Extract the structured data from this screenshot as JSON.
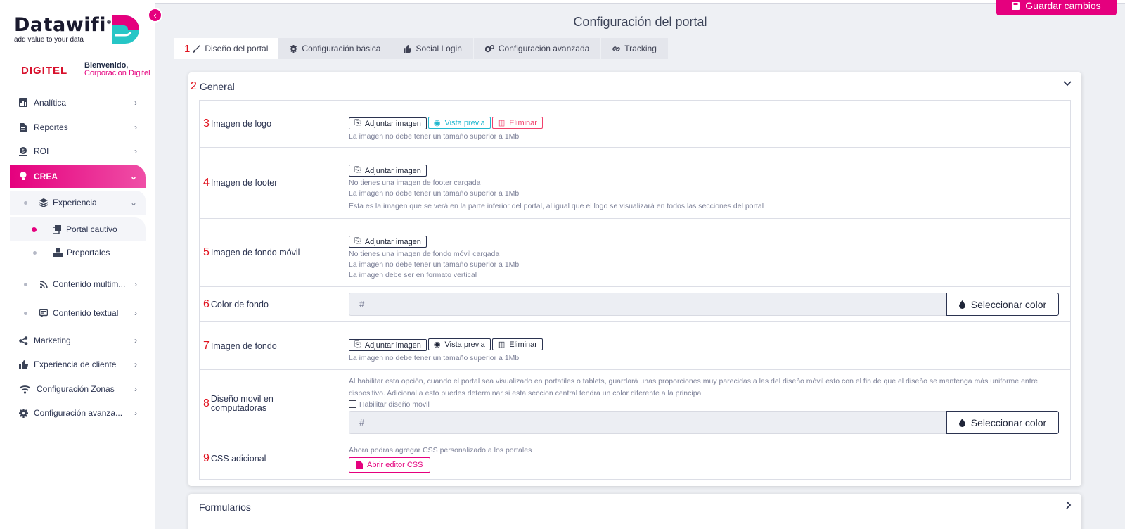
{
  "sidebar": {
    "logo_text": "Datawifi",
    "logo_reg": "®",
    "logo_tagline": "add value to your data",
    "brand": "DIGITEL",
    "welcome": "Bienvenido,",
    "user_name": "Corporacion Digitel",
    "items": [
      {
        "label": "Analítica",
        "icon": "bar-chart-icon"
      },
      {
        "label": "Reportes",
        "icon": "document-icon"
      },
      {
        "label": "ROI",
        "icon": "money-icon"
      },
      {
        "label": "CREA",
        "icon": "lightbulb-icon"
      },
      {
        "label": "Experiencia",
        "icon": "layers-icon"
      },
      {
        "label": "Portal cautivo",
        "icon": "copy-icon"
      },
      {
        "label": "Preportales",
        "icon": "cubes-icon"
      },
      {
        "label": "Contenido multim...",
        "icon": "rss-icon"
      },
      {
        "label": "Contenido textual",
        "icon": "chat-icon"
      },
      {
        "label": "Marketing",
        "icon": "share-icon"
      },
      {
        "label": "Experiencia de cliente",
        "icon": "thumbs-up-icon"
      },
      {
        "label": "Configuración Zonas",
        "icon": "wifi-icon"
      },
      {
        "label": "Configuración avanza...",
        "icon": "gear-icon"
      }
    ]
  },
  "header": {
    "save_label": "Guardar cambios",
    "title": "Configuración del portal"
  },
  "tabs": [
    {
      "num": "1",
      "label": "Diseño del portal",
      "icon": "brush-icon"
    },
    {
      "num": "",
      "label": "Configuración básica",
      "icon": "gear-icon"
    },
    {
      "num": "",
      "label": "Social Login",
      "icon": "thumbs-up-icon"
    },
    {
      "num": "",
      "label": "Configuración avanzada",
      "icon": "gears-icon"
    },
    {
      "num": "",
      "label": "Tracking",
      "icon": "link-icon"
    }
  ],
  "general": {
    "num": "2",
    "title": "General",
    "rows": {
      "logo": {
        "num": "3",
        "label": "Imagen de logo",
        "hint1": "La imagen no debe tener un tamaño superior a 1Mb"
      },
      "footer": {
        "num": "4",
        "label": "Imagen de footer",
        "hint1": "No tienes una imagen de footer cargada",
        "hint2": "La imagen no debe tener un tamaño superior a 1Mb",
        "hint3": "Esta es la imagen que se verá en la parte inferior del portal, al igual que el logo se visualizará en todos las secciones del portal"
      },
      "movil": {
        "num": "5",
        "label": "Imagen de fondo móvil",
        "hint1": "No tienes una imagen de fondo móvil cargada",
        "hint2": "La imagen no debe tener un tamaño superior a 1Mb",
        "hint3": "La imagen debe ser en formato vertical"
      },
      "color": {
        "num": "6",
        "label": "Color de fondo",
        "placeholder": "#"
      },
      "fondo": {
        "num": "7",
        "label": "Imagen de fondo",
        "hint1": "La imagen no debe tener un tamaño superior a 1Mb"
      },
      "diseno": {
        "num": "8",
        "label": "Diseño movil en computadoras",
        "hint1": "Al habilitar esta opción, cuando el portal sea visualizado en portatiles o tablets, guardará unas proporciones muy parecidas a las del diseño móvil esto con el fin de que el diseño se mantenga más uniforme entre dispositivo. Adicional a esto puedes determinar si esta seccion central tendra un color diferente a la principal",
        "checkbox_label": "Habilitar diseño movil",
        "placeholder": "#"
      },
      "css": {
        "num": "9",
        "label": "CSS adicional",
        "hint1": "Ahora podras agregar CSS personalizado a los portales",
        "button": "Abrir editor CSS"
      }
    },
    "buttons": {
      "attach": "Adjuntar imagen",
      "preview": "Vista previa",
      "delete": "Eliminar",
      "select_color": "Seleccionar color"
    }
  },
  "formularios": {
    "title": "Formularios"
  },
  "colors": {
    "accent": "#e5007e",
    "info": "#22b8cf",
    "danger": "#f1416c",
    "annotation": "#e0121e"
  }
}
